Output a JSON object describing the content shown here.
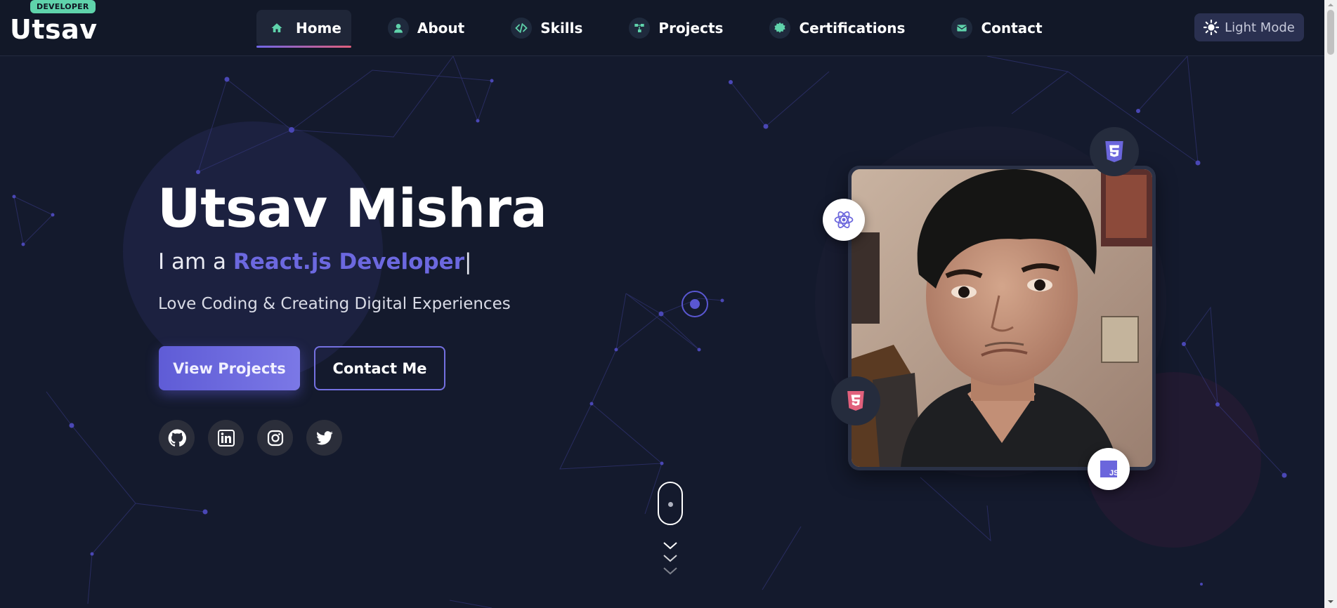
{
  "brand": {
    "badge": "DEVELOPER",
    "name": "Utsav"
  },
  "nav": {
    "items": [
      {
        "label": "Home",
        "icon": "home-icon",
        "active": true
      },
      {
        "label": "About",
        "icon": "user-icon",
        "active": false
      },
      {
        "label": "Skills",
        "icon": "code-icon",
        "active": false
      },
      {
        "label": "Projects",
        "icon": "project-icon",
        "active": false
      },
      {
        "label": "Certifications",
        "icon": "badge-icon",
        "active": false
      },
      {
        "label": "Contact",
        "icon": "mail-icon",
        "active": false
      }
    ],
    "theme_toggle": {
      "label": "Light Mode",
      "icon": "sun-icon"
    }
  },
  "hero": {
    "name": "Utsav Mishra",
    "role_prefix": "I am a ",
    "role_highlight": "React.js Developer",
    "role_cursor": "|",
    "tagline": "Love Coding & Creating Digital Experiences",
    "primary_button": "View Projects",
    "secondary_button": "Contact Me",
    "socials": [
      "github-icon",
      "linkedin-icon",
      "instagram-icon",
      "twitter-icon"
    ]
  },
  "profile": {
    "floating_badges": [
      "html5-icon",
      "react-icon",
      "css3-icon",
      "js-icon"
    ],
    "badge_js_text": "JS"
  },
  "colors": {
    "background": "#141a2d",
    "navbar": "#121828",
    "accent": "#6c68df",
    "brand_green": "#5fd3ab",
    "nav_underline_start": "#6f66e6",
    "nav_underline_end": "#e1607c"
  }
}
